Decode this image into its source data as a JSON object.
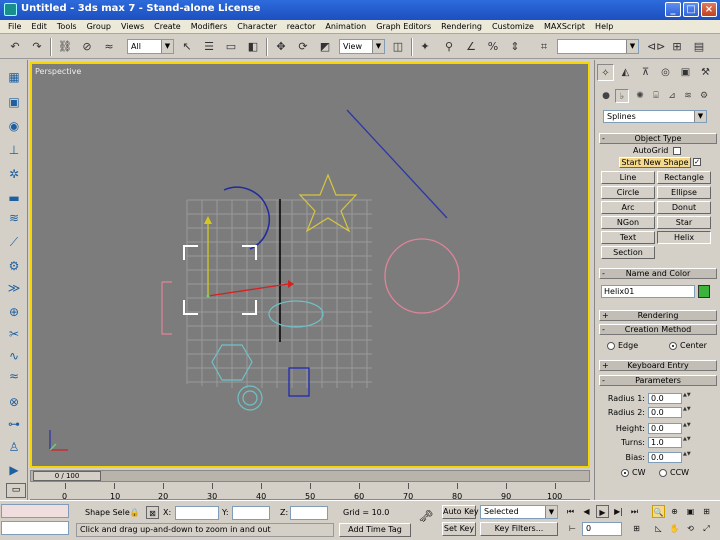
{
  "window": {
    "title": "Untitled - 3ds max 7 - Stand-alone License",
    "min": "_",
    "max": "□",
    "close": "×"
  },
  "menu": [
    "File",
    "Edit",
    "Tools",
    "Group",
    "Views",
    "Create",
    "Modifiers",
    "Character",
    "reactor",
    "Animation",
    "Graph Editors",
    "Rendering",
    "Customize",
    "MAXScript",
    "Help"
  ],
  "toolbar": {
    "selection_filter": "All",
    "reference_coord": "View",
    "named_selection": ""
  },
  "viewport": {
    "label": "Perspective"
  },
  "timeslider": {
    "label": "0 / 100"
  },
  "track_ticks": [
    "0",
    "10",
    "20",
    "30",
    "40",
    "50",
    "60",
    "70",
    "80",
    "90",
    "100"
  ],
  "command_panel": {
    "category_dropdown": "Splines",
    "object_type": {
      "title": "Object Type",
      "autogrid": "AutoGrid",
      "start_new_shape": "Start New Shape",
      "buttons": [
        "Line",
        "Rectangle",
        "Circle",
        "Ellipse",
        "Arc",
        "Donut",
        "NGon",
        "Star",
        "Text",
        "Helix",
        "Section"
      ]
    },
    "name_and_color": {
      "title": "Name and Color",
      "name": "Helix01",
      "color": "#3cb43c"
    },
    "rendering": "Rendering",
    "creation_method": {
      "title": "Creation Method",
      "options": [
        "Edge",
        "Center"
      ],
      "selected": "Center"
    },
    "keyboard_entry": "Keyboard Entry",
    "parameters": {
      "title": "Parameters",
      "fields": [
        {
          "label": "Radius 1:",
          "value": "0.0"
        },
        {
          "label": "Radius 2:",
          "value": "0.0"
        },
        {
          "label": "Height:",
          "value": "0.0"
        },
        {
          "label": "Turns:",
          "value": "1.0"
        },
        {
          "label": "Bias:",
          "value": "0.0"
        }
      ],
      "direction": [
        "CW",
        "CCW"
      ],
      "direction_selected": "CW"
    }
  },
  "statusbar": {
    "selection": "Shape Sele",
    "x_label": "X:",
    "y_label": "Y:",
    "z_label": "Z:",
    "x_value": "",
    "y_value": "",
    "z_value": "",
    "grid": "Grid = 10.0",
    "prompt": "Click and drag up-and-down to zoom in and out",
    "add_time_tag": "Add Time Tag",
    "auto_key": "Auto Key",
    "set_key": "Set Key",
    "key_mode": "Selected",
    "key_filters": "Key Filters...",
    "frame": "0"
  }
}
